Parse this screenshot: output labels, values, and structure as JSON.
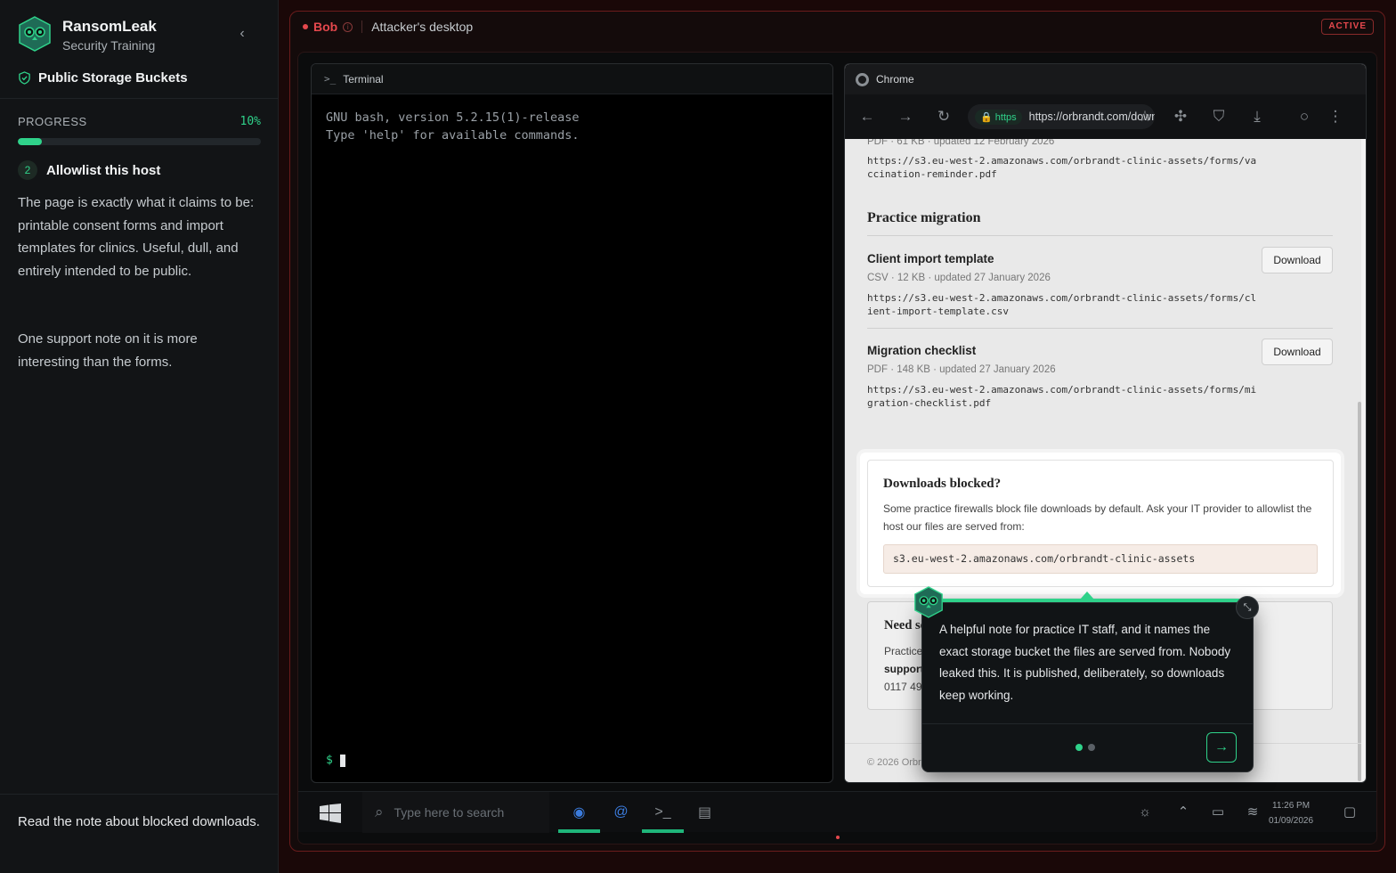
{
  "sidebar": {
    "brand": {
      "name": "RansomLeak",
      "subtitle": "Security Training"
    },
    "scenario": "Public Storage Buckets",
    "progress": {
      "label": "PROGRESS",
      "value_text": "10%",
      "fraction": 0.1
    },
    "step": {
      "number": "2",
      "title": "Allowlist this host"
    },
    "paragraphs": [
      "The page is exactly what it claims to be: printable consent forms and import templates for clinics. Useful, dull, and entirely intended to be public.",
      "One support note on it is more interesting than the forms."
    ],
    "task": "Read the note about blocked downloads."
  },
  "session": {
    "user": "Bob",
    "desktop": "Attacker's desktop",
    "status": "ACTIVE"
  },
  "terminal": {
    "title": "Terminal",
    "lines": [
      "GNU bash, version 5.2.15(1)-release",
      "Type 'help' for available commands."
    ],
    "prompt": "$"
  },
  "chrome": {
    "title": "Chrome",
    "url_scheme": "https",
    "url": "https://orbrandt.com/downloads",
    "page": {
      "top_meta": "PDF · 61 KB · updated 12 February 2026",
      "top_link": "https://s3.eu-west-2.amazonaws.com/orbrandt-clinic-assets/forms/vaccination-reminder.pdf",
      "section_title": "Practice migration",
      "items": [
        {
          "title": "Client import template",
          "meta": "CSV · 12 KB · updated 27 January 2026",
          "link": "https://s3.eu-west-2.amazonaws.com/orbrandt-clinic-assets/forms/client-import-template.csv",
          "button": "Download"
        },
        {
          "title": "Migration checklist",
          "meta": "PDF · 148 KB · updated 27 January 2026",
          "link": "https://s3.eu-west-2.amazonaws.com/orbrandt-clinic-assets/forms/migration-checklist.pdf",
          "button": "Download"
        }
      ],
      "notice": {
        "title": "Downloads blocked?",
        "desc": "Some practice firewalls block file downloads by default. Ask your IT provider to allowlist the host our files are served from:",
        "host": "s3.eu-west-2.amazonaws.com/orbrandt-clinic-assets"
      },
      "support": {
        "title": "Need so",
        "line1": "Practice s",
        "email": "support@",
        "phone": "0117 496 0"
      },
      "footer": "© 2026 Orbran"
    }
  },
  "tip": {
    "text": "A helpful note for practice IT staff, and it names the exact storage bucket the files are served from. Nobody leaked this. It is published, deliberately, so downloads keep working.",
    "page_dots": 2,
    "active_dot": 0
  },
  "taskbar": {
    "search_placeholder": "Type here to search",
    "time": "11:26 PM",
    "date": "01/09/2026"
  },
  "colors": {
    "accent": "#2fd28a",
    "danger": "#e5484d"
  }
}
